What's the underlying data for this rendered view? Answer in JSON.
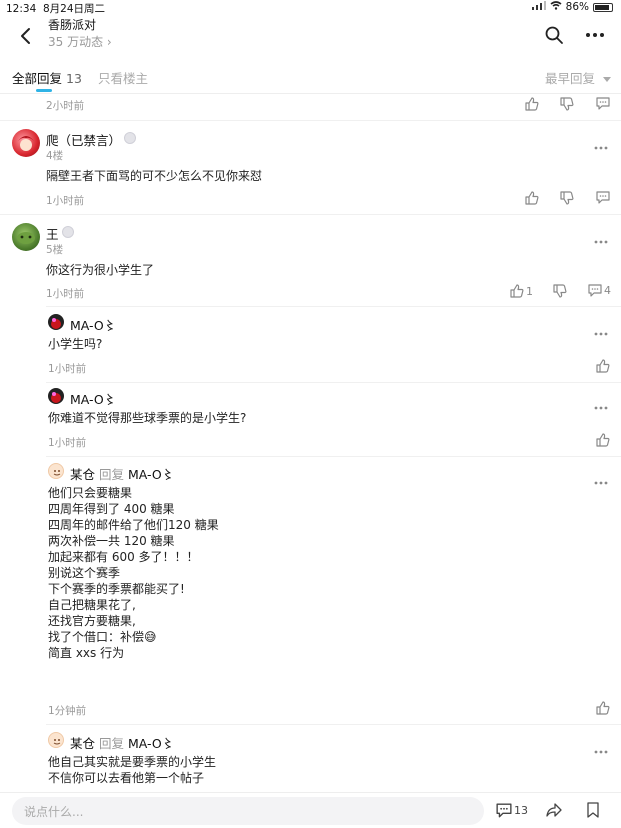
{
  "status": {
    "time": "12:34",
    "date": "8月24日周二",
    "battery": "86%"
  },
  "header": {
    "title": "香肠派对",
    "subtitle": "35 万动态 ›"
  },
  "tabs": {
    "all_label": "全部回复",
    "all_count": "13",
    "owner_label": "只看楼主",
    "sort_label": "最早回复"
  },
  "top_row": {
    "time": "2小时前"
  },
  "posts": [
    {
      "name": "爬（已禁言）",
      "floor": "4楼",
      "text": "隔壁王者下面骂的可不少怎么不见你来怼",
      "time": "1小时前"
    },
    {
      "name": "王",
      "floor": "5楼",
      "text": "你这行为很小学生了",
      "time": "1小时前",
      "likes": "1",
      "comments": "4"
    }
  ],
  "replies": [
    {
      "name": "MA-O〻",
      "text": "小学生吗?",
      "time": "1小时前"
    },
    {
      "name": "MA-O〻",
      "text": "你难道不觉得那些球季票的是小学生?",
      "time": "1小时前"
    },
    {
      "name": "某仓",
      "reply_word": "回复",
      "reply_to": "MA-O〻",
      "lines": [
        "他们只会要糖果",
        "四周年得到了 400 糖果",
        "四周年的邮件给了他们120 糖果",
        "两次补偿一共 120 糖果",
        "加起来都有 600 多了！！！",
        "别说这个赛季",
        "下个赛季的季票都能买了!",
        "自己把糖果花了,",
        "还找官方要糖果,",
        "找了个借口：补偿😅",
        "简直 xxs 行为"
      ],
      "time": "1分钟前"
    },
    {
      "name": "某仓",
      "reply_word": "回复",
      "reply_to": "MA-O〻",
      "lines": [
        "他自己其实就是要季票的小学生",
        "不信你可以去看他第一个帖子"
      ]
    }
  ],
  "bottom": {
    "placeholder": "说点什么...",
    "comment_count": "13"
  }
}
